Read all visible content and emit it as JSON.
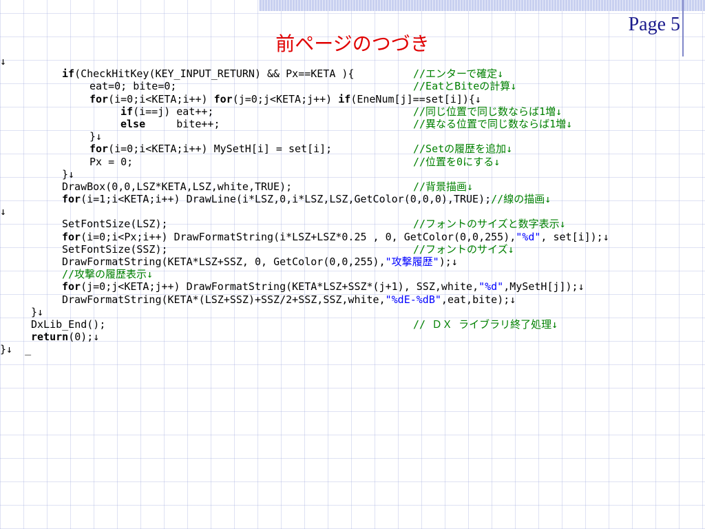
{
  "page_label": "Page 5",
  "title": "前ページのつづき",
  "code_lines": [
    {
      "indent": 0,
      "code": "↓",
      "comment": ""
    },
    {
      "indent": 90,
      "code": "if(CheckHitKey(KEY_INPUT_RETURN) && Px==KETA ){",
      "comment": "//エンターで確定↓"
    },
    {
      "indent": 130,
      "code": "eat=0; bite=0;",
      "comment": "//EatとBiteの計算↓"
    },
    {
      "indent": 130,
      "code": "for(i=0;i<KETA;i++) for(j=0;j<KETA;j++) if(EneNum[j]==set[i]){↓",
      "comment": ""
    },
    {
      "indent": 175,
      "code": "if(i==j) eat++;",
      "comment": "//同じ位置で同じ数ならば1増↓"
    },
    {
      "indent": 175,
      "code": "else     bite++;",
      "comment": "//異なる位置で同じ数ならば1増↓"
    },
    {
      "indent": 130,
      "code": "}↓",
      "comment": ""
    },
    {
      "indent": 130,
      "code": "for(i=0;i<KETA;i++) MySetH[i] = set[i];",
      "comment": "//Setの履歴を追加↓"
    },
    {
      "indent": 130,
      "code": "Px = 0;",
      "comment": "//位置を0にする↓"
    },
    {
      "indent": 90,
      "code": "}↓",
      "comment": ""
    },
    {
      "indent": 90,
      "code": "DrawBox(0,0,LSZ*KETA,LSZ,white,TRUE);",
      "comment": "//背景描画↓"
    },
    {
      "indent": 90,
      "code": "for(i=1;i<KETA;i++) DrawLine(i*LSZ,0,i*LSZ,LSZ,GetColor(0,0,0),TRUE);//線の描画↓",
      "comment": ""
    },
    {
      "indent": 0,
      "code": "↓",
      "comment": ""
    },
    {
      "indent": 90,
      "code": "SetFontSize(LSZ);",
      "comment": "//フォントのサイズと数字表示↓"
    },
    {
      "indent": 90,
      "code": "for(i=0;i<Px;i++) DrawFormatString(i*LSZ+LSZ*0.25 , 0, GetColor(0,0,255),\"%d\", set[i]);↓",
      "comment": ""
    },
    {
      "indent": 90,
      "code": "SetFontSize(SSZ);",
      "comment": "//フォントのサイズ↓"
    },
    {
      "indent": 90,
      "code": "DrawFormatString(KETA*LSZ+SSZ, 0, GetColor(0,0,255),\"攻撃履歴\");↓",
      "comment": ""
    },
    {
      "indent": 90,
      "code": "//攻撃の履歴表示↓",
      "comment": ""
    },
    {
      "indent": 90,
      "code": "for(j=0;j<KETA;j++) DrawFormatString(KETA*LSZ+SSZ*(j+1), SSZ,white,\"%d\",MySetH[j]);↓",
      "comment": ""
    },
    {
      "indent": 90,
      "code": "DrawFormatString(KETA*(LSZ+SSZ)+SSZ/2+SSZ,SSZ,white,\"%dE-%dB\",eat,bite);↓",
      "comment": ""
    },
    {
      "indent": 45,
      "code": "}↓",
      "comment": ""
    },
    {
      "indent": 45,
      "code": "DxLib_End();",
      "comment": "// ＤＸ ライブラリ終了処理↓"
    },
    {
      "indent": 45,
      "code": "return(0);↓",
      "comment": ""
    },
    {
      "indent": 0,
      "code": "}↓  _",
      "comment": ""
    }
  ]
}
